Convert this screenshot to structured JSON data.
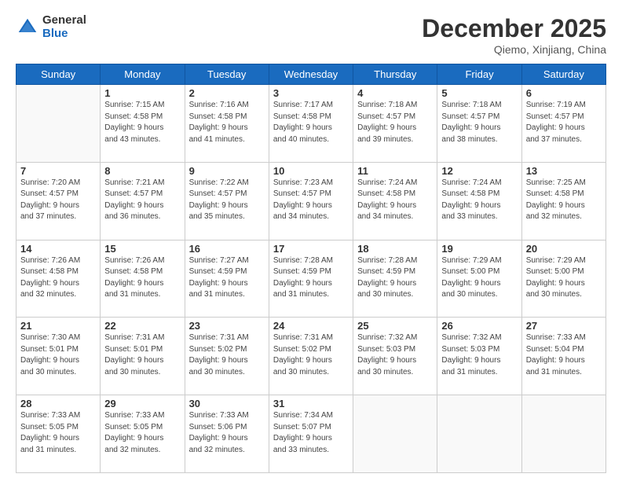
{
  "header": {
    "logo_general": "General",
    "logo_blue": "Blue",
    "month_title": "December 2025",
    "location": "Qiemo, Xinjiang, China"
  },
  "days_of_week": [
    "Sunday",
    "Monday",
    "Tuesday",
    "Wednesday",
    "Thursday",
    "Friday",
    "Saturday"
  ],
  "weeks": [
    [
      {
        "day": "",
        "info": ""
      },
      {
        "day": "1",
        "info": "Sunrise: 7:15 AM\nSunset: 4:58 PM\nDaylight: 9 hours\nand 43 minutes."
      },
      {
        "day": "2",
        "info": "Sunrise: 7:16 AM\nSunset: 4:58 PM\nDaylight: 9 hours\nand 41 minutes."
      },
      {
        "day": "3",
        "info": "Sunrise: 7:17 AM\nSunset: 4:58 PM\nDaylight: 9 hours\nand 40 minutes."
      },
      {
        "day": "4",
        "info": "Sunrise: 7:18 AM\nSunset: 4:57 PM\nDaylight: 9 hours\nand 39 minutes."
      },
      {
        "day": "5",
        "info": "Sunrise: 7:18 AM\nSunset: 4:57 PM\nDaylight: 9 hours\nand 38 minutes."
      },
      {
        "day": "6",
        "info": "Sunrise: 7:19 AM\nSunset: 4:57 PM\nDaylight: 9 hours\nand 37 minutes."
      }
    ],
    [
      {
        "day": "7",
        "info": "Sunrise: 7:20 AM\nSunset: 4:57 PM\nDaylight: 9 hours\nand 37 minutes."
      },
      {
        "day": "8",
        "info": "Sunrise: 7:21 AM\nSunset: 4:57 PM\nDaylight: 9 hours\nand 36 minutes."
      },
      {
        "day": "9",
        "info": "Sunrise: 7:22 AM\nSunset: 4:57 PM\nDaylight: 9 hours\nand 35 minutes."
      },
      {
        "day": "10",
        "info": "Sunrise: 7:23 AM\nSunset: 4:57 PM\nDaylight: 9 hours\nand 34 minutes."
      },
      {
        "day": "11",
        "info": "Sunrise: 7:24 AM\nSunset: 4:58 PM\nDaylight: 9 hours\nand 34 minutes."
      },
      {
        "day": "12",
        "info": "Sunrise: 7:24 AM\nSunset: 4:58 PM\nDaylight: 9 hours\nand 33 minutes."
      },
      {
        "day": "13",
        "info": "Sunrise: 7:25 AM\nSunset: 4:58 PM\nDaylight: 9 hours\nand 32 minutes."
      }
    ],
    [
      {
        "day": "14",
        "info": "Sunrise: 7:26 AM\nSunset: 4:58 PM\nDaylight: 9 hours\nand 32 minutes."
      },
      {
        "day": "15",
        "info": "Sunrise: 7:26 AM\nSunset: 4:58 PM\nDaylight: 9 hours\nand 31 minutes."
      },
      {
        "day": "16",
        "info": "Sunrise: 7:27 AM\nSunset: 4:59 PM\nDaylight: 9 hours\nand 31 minutes."
      },
      {
        "day": "17",
        "info": "Sunrise: 7:28 AM\nSunset: 4:59 PM\nDaylight: 9 hours\nand 31 minutes."
      },
      {
        "day": "18",
        "info": "Sunrise: 7:28 AM\nSunset: 4:59 PM\nDaylight: 9 hours\nand 30 minutes."
      },
      {
        "day": "19",
        "info": "Sunrise: 7:29 AM\nSunset: 5:00 PM\nDaylight: 9 hours\nand 30 minutes."
      },
      {
        "day": "20",
        "info": "Sunrise: 7:29 AM\nSunset: 5:00 PM\nDaylight: 9 hours\nand 30 minutes."
      }
    ],
    [
      {
        "day": "21",
        "info": "Sunrise: 7:30 AM\nSunset: 5:01 PM\nDaylight: 9 hours\nand 30 minutes."
      },
      {
        "day": "22",
        "info": "Sunrise: 7:31 AM\nSunset: 5:01 PM\nDaylight: 9 hours\nand 30 minutes."
      },
      {
        "day": "23",
        "info": "Sunrise: 7:31 AM\nSunset: 5:02 PM\nDaylight: 9 hours\nand 30 minutes."
      },
      {
        "day": "24",
        "info": "Sunrise: 7:31 AM\nSunset: 5:02 PM\nDaylight: 9 hours\nand 30 minutes."
      },
      {
        "day": "25",
        "info": "Sunrise: 7:32 AM\nSunset: 5:03 PM\nDaylight: 9 hours\nand 30 minutes."
      },
      {
        "day": "26",
        "info": "Sunrise: 7:32 AM\nSunset: 5:03 PM\nDaylight: 9 hours\nand 31 minutes."
      },
      {
        "day": "27",
        "info": "Sunrise: 7:33 AM\nSunset: 5:04 PM\nDaylight: 9 hours\nand 31 minutes."
      }
    ],
    [
      {
        "day": "28",
        "info": "Sunrise: 7:33 AM\nSunset: 5:05 PM\nDaylight: 9 hours\nand 31 minutes."
      },
      {
        "day": "29",
        "info": "Sunrise: 7:33 AM\nSunset: 5:05 PM\nDaylight: 9 hours\nand 32 minutes."
      },
      {
        "day": "30",
        "info": "Sunrise: 7:33 AM\nSunset: 5:06 PM\nDaylight: 9 hours\nand 32 minutes."
      },
      {
        "day": "31",
        "info": "Sunrise: 7:34 AM\nSunset: 5:07 PM\nDaylight: 9 hours\nand 33 minutes."
      },
      {
        "day": "",
        "info": ""
      },
      {
        "day": "",
        "info": ""
      },
      {
        "day": "",
        "info": ""
      }
    ]
  ]
}
